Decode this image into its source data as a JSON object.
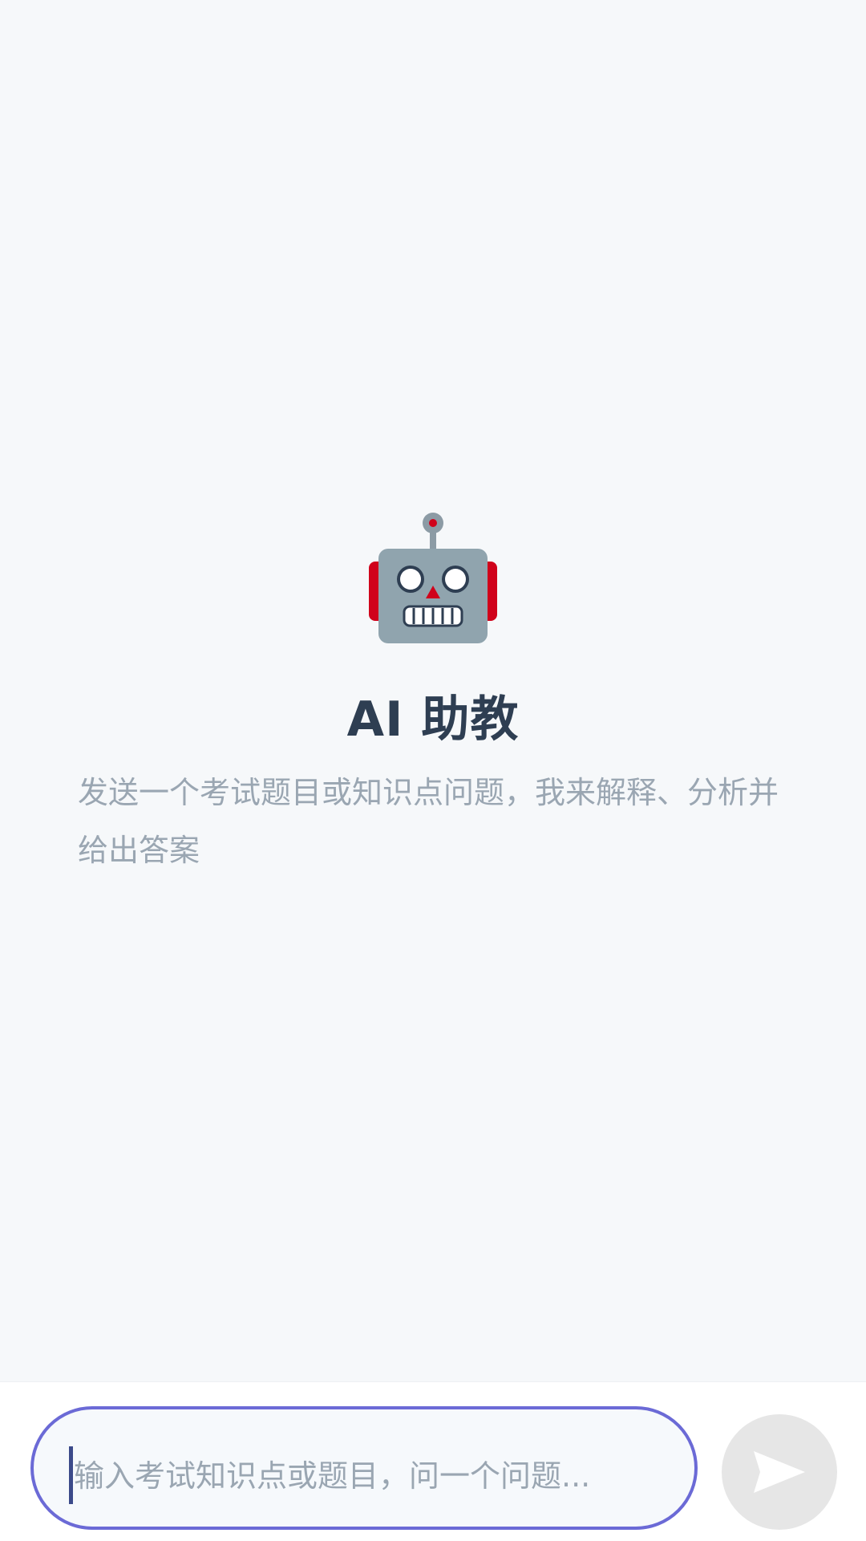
{
  "empty_state": {
    "icon": "robot-icon",
    "title": "AI 助教",
    "description": "发送一个考试题目或知识点问题，我来解释、分析并给出答案"
  },
  "composer": {
    "placeholder": "输入考试知识点或题目，问一个问题...",
    "value": "",
    "send_icon": "send-icon"
  },
  "colors": {
    "background": "#f6f8fa",
    "accent_border": "#6b6ad6",
    "title": "#2e3e52",
    "muted_text": "#9aa6b2",
    "send_button_bg": "#e6e6e6"
  }
}
